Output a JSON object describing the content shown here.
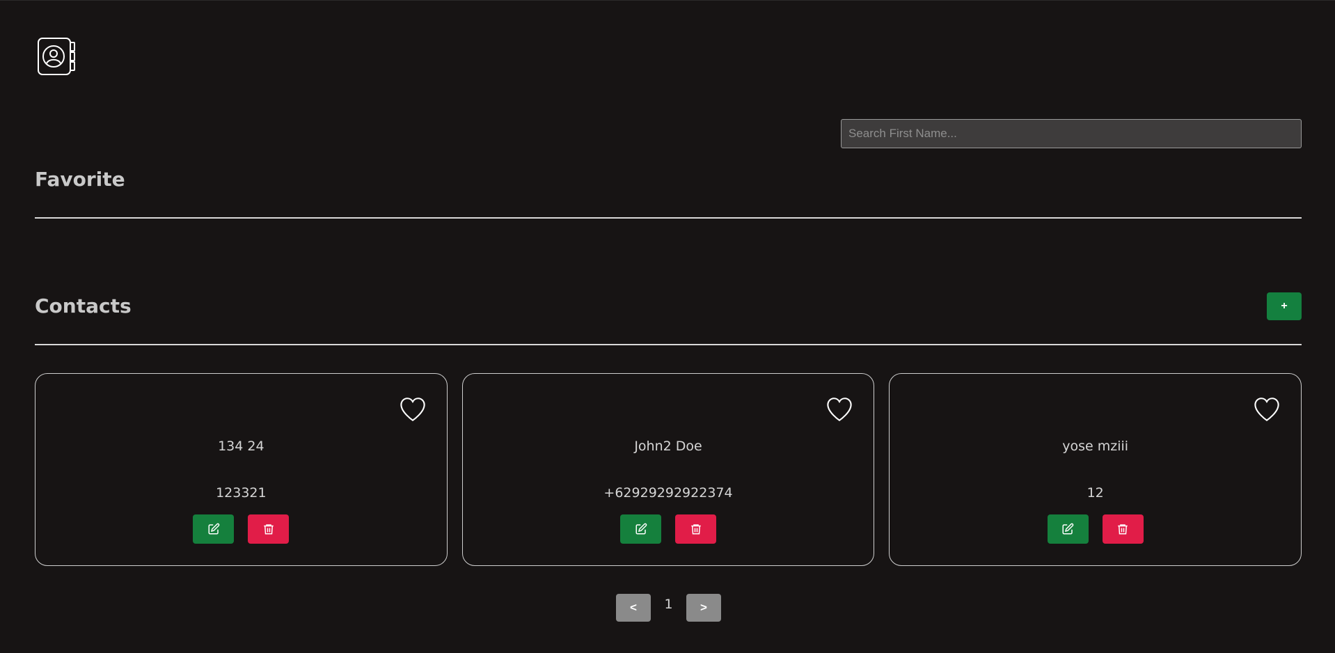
{
  "header": {
    "logo_icon": "contact-book-icon"
  },
  "search": {
    "placeholder": "Search First Name..."
  },
  "favorite": {
    "title": "Favorite"
  },
  "contacts": {
    "title": "Contacts",
    "add_label": "+",
    "items": [
      {
        "name": "134 24",
        "phone": "123321"
      },
      {
        "name": "John2 Doe",
        "phone": "+62929292922374"
      },
      {
        "name": "yose mziii",
        "phone": "12"
      }
    ]
  },
  "pagination": {
    "prev_label": "<",
    "page": "1",
    "next_label": ">"
  },
  "colors": {
    "background": "#171414",
    "edit": "#15803d",
    "delete": "#e11d48",
    "add": "#14803f",
    "pager": "#8a8a8a"
  }
}
